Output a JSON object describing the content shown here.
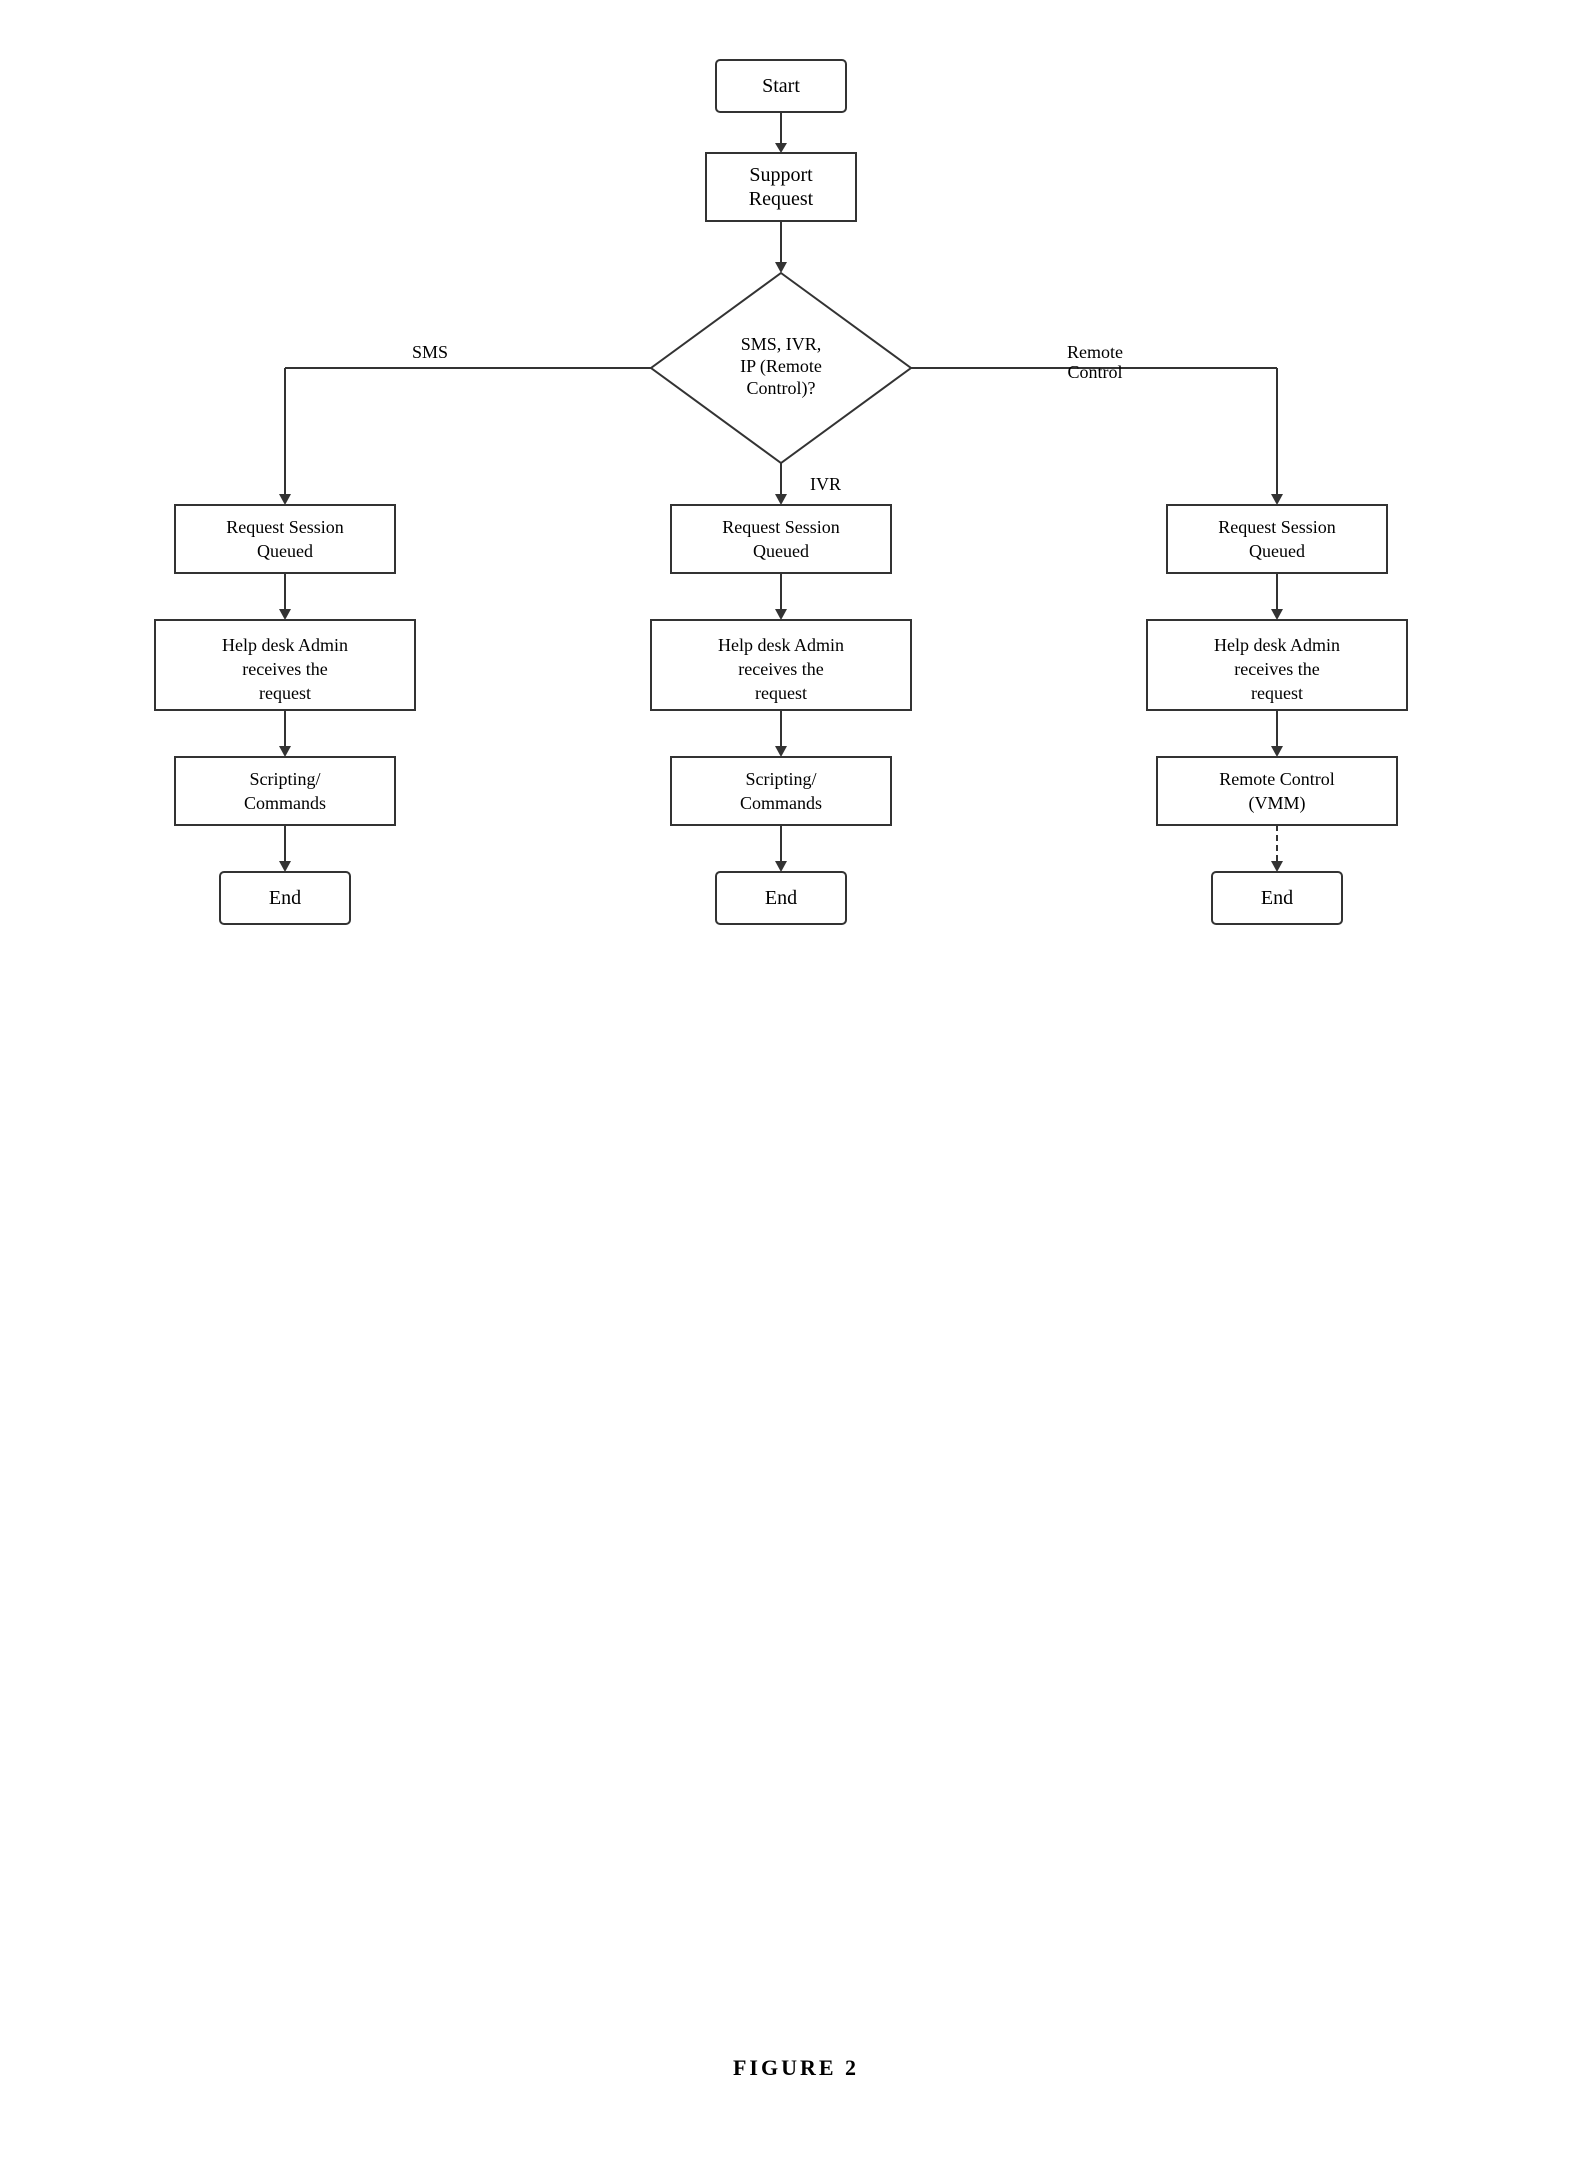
{
  "diagram": {
    "title": "FIGURE 2",
    "nodes": {
      "start": "Start",
      "support_request": "Support\nRequest",
      "decision": "SMS, IVR,\nIP (Remote\nControl)?",
      "sms_label": "SMS",
      "ivr_label": "IVR",
      "remote_label": "Remote\nControl",
      "sms_queued": "Request Session\nQueued",
      "ivr_queued": "Request Session\nQueued",
      "remote_queued": "Request Session\nQueued",
      "sms_helpdesk": "Help desk Admin\nreceives the\nrequest",
      "ivr_helpdesk": "Help desk Admin\nreceives the\nrequest",
      "remote_helpdesk": "Help desk Admin\nreceives the\nrequest",
      "sms_scripting": "Scripting/\nCommands",
      "ivr_scripting": "Scripting/\nCommands",
      "remote_control": "Remote Control\n(VMM)",
      "sms_end": "End",
      "ivr_end": "End",
      "remote_end": "End"
    }
  }
}
